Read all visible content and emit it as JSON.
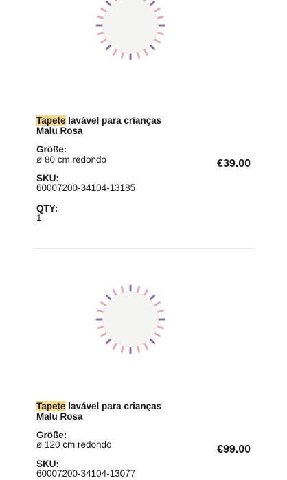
{
  "items": [
    {
      "title_highlight": "Tapete",
      "title_rest": " lavável para crianças",
      "title_line2": "Malu Rosa",
      "size_label": "Größe:",
      "size_value": "ø 80 cm redondo",
      "sku_label": "SKU:",
      "sku_value": "60007200-34104-13185",
      "qty_label": "QTY:",
      "qty_value": "1",
      "price": "€39.00",
      "image_icon": "round-rug-pink-tassels"
    },
    {
      "title_highlight": "Tapete",
      "title_rest": " lavável para crianças",
      "title_line2": "Malu Rosa",
      "size_label": "Größe:",
      "size_value": "ø 120 cm redondo",
      "sku_label": "SKU:",
      "sku_value": "60007200-34104-13077",
      "price": "€99.00",
      "image_icon": "round-rug-pink-tassels"
    }
  ],
  "colors": {
    "highlight": "#f6d98a",
    "tassel_pink": "#e9a9b6",
    "tassel_purple": "#8b6f9c"
  }
}
